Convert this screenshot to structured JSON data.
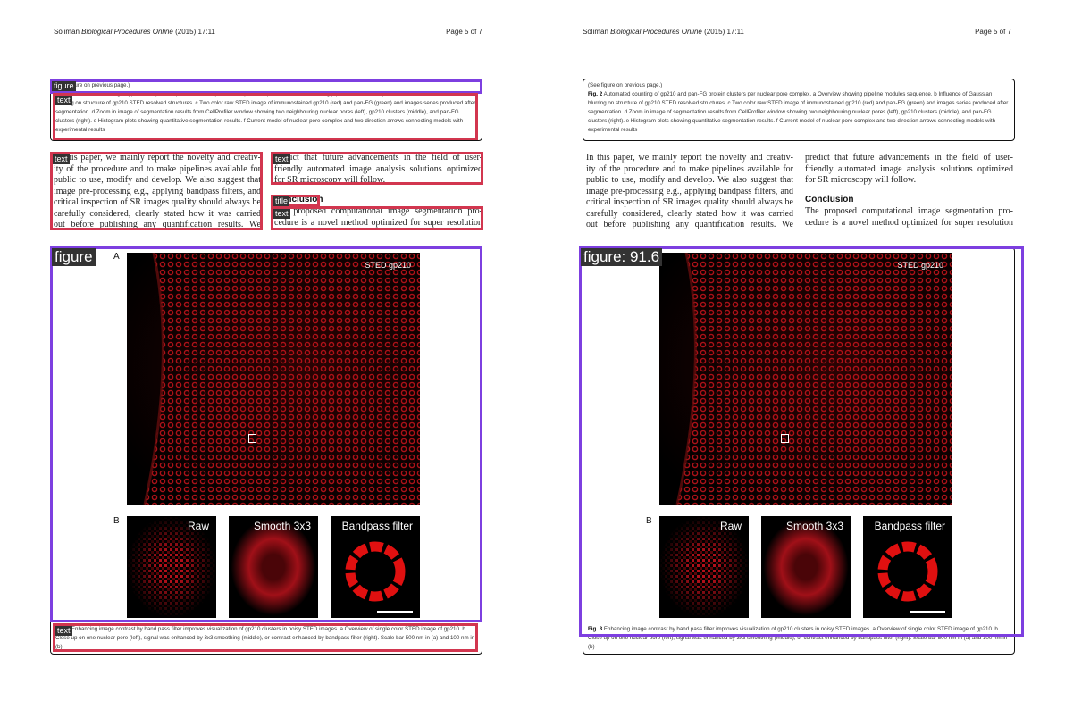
{
  "header": {
    "author": "Soliman",
    "journal": "Biological Procedures Online",
    "year_time": "(2015) 17:11",
    "page": "Page 5 of 7"
  },
  "fig2_caption": {
    "see_prev": "(See figure on previous page.)",
    "title": "Fig. 2",
    "text": "Automated counting of gp210 and pan-FG protein clusters per nuclear pore complex. a Overview showing pipeline modules sequence. b Influence of Gaussian blurring on structure of gp210 STED resolved structures. c Two color raw STED image of immunostained gp210 (red) and pan-FG (green) and images series produced after segmentation. d Zoom in image of segmentation results from CellProfiler window showing two neighbouring nuclear pores (left), gp210 clusters (middle), and pan-FG clusters (right). e Histogram plots showing quantitative segmentation results. f Current model of nuclear pore complex and two direction arrows connecting models with experimental results"
  },
  "col1_lines": [
    "In this paper, we mainly report the novelty and creativ-",
    "ity of the procedure and to make pipelines available for",
    "public to use, modify and develop. We also suggest that",
    "image pre-processing e.g., applying bandpass filters, and",
    "critical inspection of SR images quality should always be",
    "carefully considered, clearly stated how it was carried",
    "out before publishing any quantification results. We"
  ],
  "col2_lines": [
    "predict that future advancements in the field of user-",
    "friendly automated image analysis solutions optimized",
    "for SR microscopy will follow."
  ],
  "conclusion": {
    "heading": "Conclusion",
    "lines": [
      "The proposed computational image segmentation pro-",
      "cedure is a novel method optimized for super resolution"
    ]
  },
  "fig3": {
    "panel_a": "A",
    "panel_b": "B",
    "sted_label": "STED gp210",
    "tiles": [
      "Raw",
      "Smooth 3x3",
      "Bandpass filter"
    ]
  },
  "fig3_caption": {
    "title": "Fig. 3",
    "text": "Enhancing image contrast by band pass filter improves visualization of gp210 clusters in noisy STED images. a Overview of single color STED image of gp210. b Close up on one nuclear pore (left), signal was enhanced by 3x3 smoothing (middle), or contrast enhanced by bandpass filter (right). Scale bar 500 nm in (a) and 100 nm in (b)"
  },
  "annotations": {
    "left": {
      "figure": "figure",
      "text": "text",
      "title": "title"
    },
    "right": {
      "figure_score": "figure: 91.6"
    }
  },
  "colors": {
    "red_box": "#d2364f",
    "purple_box": "#7d3fe0",
    "tag_bg": "#333333"
  }
}
